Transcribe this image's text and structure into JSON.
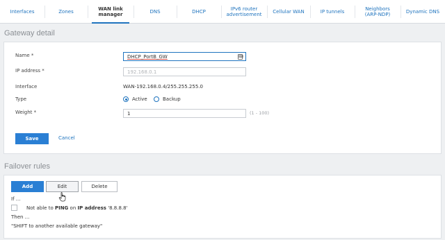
{
  "tabs": [
    {
      "label": "Interfaces",
      "active": false
    },
    {
      "label": "Zones",
      "active": false
    },
    {
      "label": "WAN link manager",
      "active": true
    },
    {
      "label": "DNS",
      "active": false
    },
    {
      "label": "DHCP",
      "active": false
    },
    {
      "label": "IPv6 router advertisement",
      "active": false
    },
    {
      "label": "Cellular WAN",
      "active": false
    },
    {
      "label": "IP tunnels",
      "active": false
    },
    {
      "label": "Neighbors (ARP-NDP)",
      "active": false
    },
    {
      "label": "Dynamic DNS",
      "active": false
    }
  ],
  "gateway_detail": {
    "title": "Gateway detail",
    "name_label": "Name *",
    "name_value": "DHCP_PortB_GW",
    "ip_label": "IP address *",
    "ip_placeholder": "192.168.0.1",
    "interface_label": "Interface",
    "interface_value": "WAN-192.168.0.4/255.255.255.0",
    "type_label": "Type",
    "type_options": [
      "Active",
      "Backup"
    ],
    "type_selected": "Active",
    "weight_label": "Weight *",
    "weight_value": "1",
    "weight_hint": "(1 - 100)",
    "save_label": "Save",
    "cancel_label": "Cancel"
  },
  "failover_rules": {
    "title": "Failover rules",
    "add_label": "Add",
    "edit_label": "Edit",
    "delete_label": "Delete",
    "if_label": "If ...",
    "rule_prefix": "Not able to",
    "rule_protocol": "PING",
    "rule_on": "on",
    "rule_ip_label": "IP address",
    "rule_ip": "'8.8.8.8'",
    "then_label": "Then ...",
    "then_action": "\"SHIFT to another available gateway\""
  },
  "colors": {
    "accent": "#1e73be",
    "primary_button": "#2a7fd4",
    "background": "#eef0f2"
  }
}
